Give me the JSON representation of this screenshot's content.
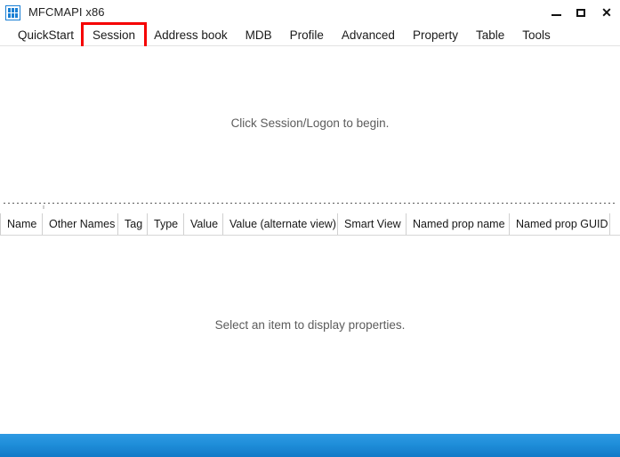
{
  "window": {
    "title": "MFCMAPI x86",
    "icon": "app-grid-icon",
    "controls": {
      "minimize": "–",
      "maximize": "▢",
      "close": "✕"
    }
  },
  "menu": {
    "items": [
      {
        "label": "QuickStart",
        "highlighted": false
      },
      {
        "label": "Session",
        "highlighted": true
      },
      {
        "label": "Address book",
        "highlighted": false
      },
      {
        "label": "MDB",
        "highlighted": false
      },
      {
        "label": "Profile",
        "highlighted": false
      },
      {
        "label": "Advanced",
        "highlighted": false
      },
      {
        "label": "Property",
        "highlighted": false
      },
      {
        "label": "Table",
        "highlighted": false
      },
      {
        "label": "Tools",
        "highlighted": false
      }
    ],
    "highlight_color": "#f50000"
  },
  "upper_pane": {
    "message": "Click Session/Logon to begin."
  },
  "columns": [
    {
      "label": "Name",
      "width": 48
    },
    {
      "label": "Other Names",
      "width": 85
    },
    {
      "label": "Tag",
      "width": 33
    },
    {
      "label": "Type",
      "width": 41
    },
    {
      "label": "Value",
      "width": 44
    },
    {
      "label": "Value (alternate view)",
      "width": 129
    },
    {
      "label": "Smart View",
      "width": 77
    },
    {
      "label": "Named prop name",
      "width": 116
    },
    {
      "label": "Named prop GUID",
      "width": 113
    }
  ],
  "lower_pane": {
    "message": "Select an item to display properties."
  },
  "bottom_bar": {
    "color": "#1f8ed9"
  }
}
